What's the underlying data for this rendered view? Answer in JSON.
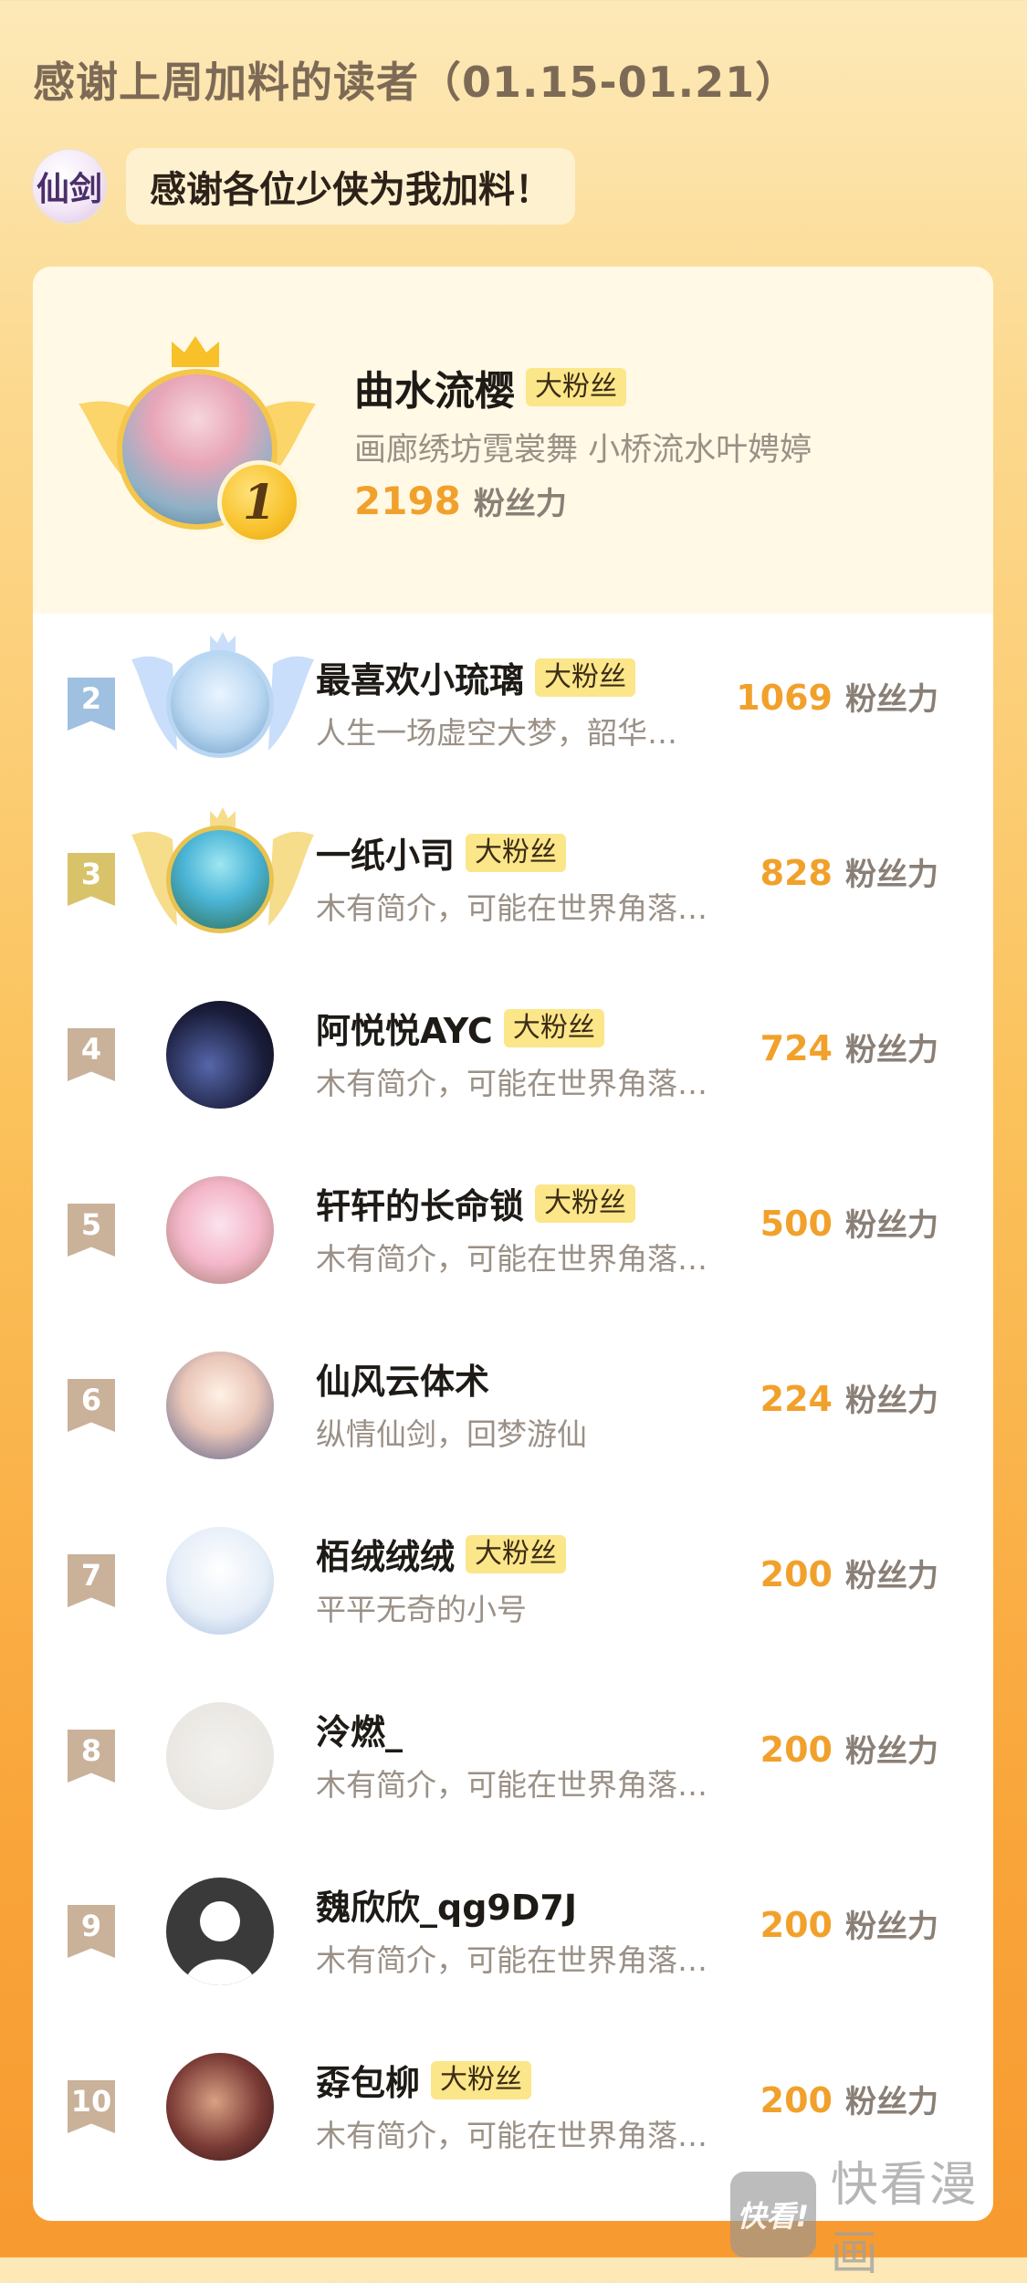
{
  "header": {
    "title": "感谢上周加料的读者（01.15-01.21）"
  },
  "author": {
    "avatar_text": "仙剑",
    "message": "感谢各位少侠为我加料！"
  },
  "top": {
    "rank": "1",
    "name": "曲水流樱",
    "tag": "大粉丝",
    "bio": "画廊绣坊霓裳舞 小桥流水叶娉婷",
    "score": "2198",
    "unit": "粉丝力"
  },
  "rows": [
    {
      "rank": "2",
      "name": "最喜欢小琉璃",
      "tag": "大粉丝",
      "bio": "人生一场虚空大梦，韶华…",
      "score": "1069",
      "unit": "粉丝力",
      "flag_color": "#9fc0e0"
    },
    {
      "rank": "3",
      "name": "一纸小司",
      "tag": "大粉丝",
      "bio": "木有简介，可能在世界角落…",
      "score": "828",
      "unit": "粉丝力",
      "flag_color": "#d9c36a"
    },
    {
      "rank": "4",
      "name": "阿悦悦AYC",
      "tag": "大粉丝",
      "bio": "木有简介，可能在世界角落…",
      "score": "724",
      "unit": "粉丝力",
      "flag_color": "#c9b19a"
    },
    {
      "rank": "5",
      "name": "轩轩的长命锁",
      "tag": "大粉丝",
      "bio": "木有简介，可能在世界角落…",
      "score": "500",
      "unit": "粉丝力",
      "flag_color": "#c9b19a"
    },
    {
      "rank": "6",
      "name": "仙风云体术",
      "tag": "",
      "bio": "纵情仙剑，回梦游仙",
      "score": "224",
      "unit": "粉丝力",
      "flag_color": "#c9b19a"
    },
    {
      "rank": "7",
      "name": "栢绒绒绒",
      "tag": "大粉丝",
      "bio": "平平无奇的小号",
      "score": "200",
      "unit": "粉丝力",
      "flag_color": "#c9b19a"
    },
    {
      "rank": "8",
      "name": "泠燃_",
      "tag": "",
      "bio": "木有简介，可能在世界角落…",
      "score": "200",
      "unit": "粉丝力",
      "flag_color": "#c9b19a"
    },
    {
      "rank": "9",
      "name": "魏欣欣_qg9D7J",
      "tag": "",
      "bio": "木有简介，可能在世界角落…",
      "score": "200",
      "unit": "粉丝力",
      "flag_color": "#c9b19a"
    },
    {
      "rank": "10",
      "name": "孬包柳",
      "tag": "大粉丝",
      "bio": "木有简介，可能在世界角落…",
      "score": "200",
      "unit": "粉丝力",
      "flag_color": "#c9b19a"
    }
  ],
  "watermark": {
    "logo": "快看!",
    "text": "快看漫画"
  }
}
